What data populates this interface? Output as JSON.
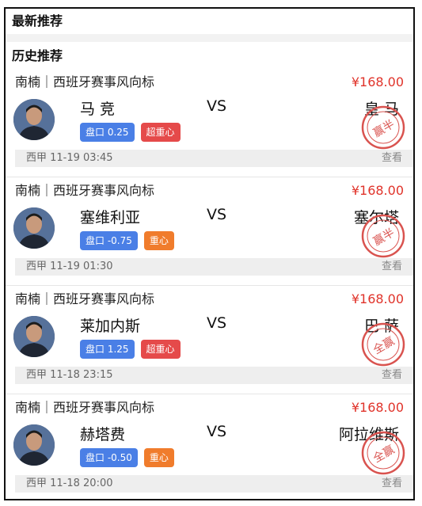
{
  "latest": {
    "title": "最新推荐"
  },
  "history": {
    "title": "历史推荐",
    "items": [
      {
        "source": "南楠｜西班牙赛事风向标",
        "price": "¥168.00",
        "home": "马 竞",
        "vs": "VS",
        "away": "皇 马",
        "tag1": "盘口 0.25",
        "tag2": "超重心",
        "tag2_style": "red",
        "stamp": "赢半",
        "meta": "西甲 11-19 03:45",
        "view": "查看"
      },
      {
        "source": "南楠｜西班牙赛事风向标",
        "price": "¥168.00",
        "home": "塞维利亚",
        "vs": "VS",
        "away": "塞尔塔",
        "tag1": "盘口 -0.75",
        "tag2": "重心",
        "tag2_style": "orange",
        "stamp": "赢半",
        "meta": "西甲 11-19 01:30",
        "view": "查看"
      },
      {
        "source": "南楠｜西班牙赛事风向标",
        "price": "¥168.00",
        "home": "莱加内斯",
        "vs": "VS",
        "away": "巴 萨",
        "tag1": "盘口 1.25",
        "tag2": "超重心",
        "tag2_style": "red",
        "stamp": "全赢",
        "meta": "西甲 11-18 23:15",
        "view": "查看"
      },
      {
        "source": "南楠｜西班牙赛事风向标",
        "price": "¥168.00",
        "home": "赫塔费",
        "vs": "VS",
        "away": "阿拉维斯",
        "tag1": "盘口 -0.50",
        "tag2": "重心",
        "tag2_style": "orange",
        "stamp": "全赢",
        "meta": "西甲 11-18 20:00",
        "view": "查看"
      }
    ]
  },
  "colors": {
    "price": "#e0332a",
    "tag_blue": "#4a7fe6",
    "tag_red": "#e54a4a",
    "tag_orange": "#f07c2c",
    "stamp": "#d9534f"
  },
  "icons": {
    "avatar": "person-avatar",
    "stamp": "result-stamp-icon"
  }
}
